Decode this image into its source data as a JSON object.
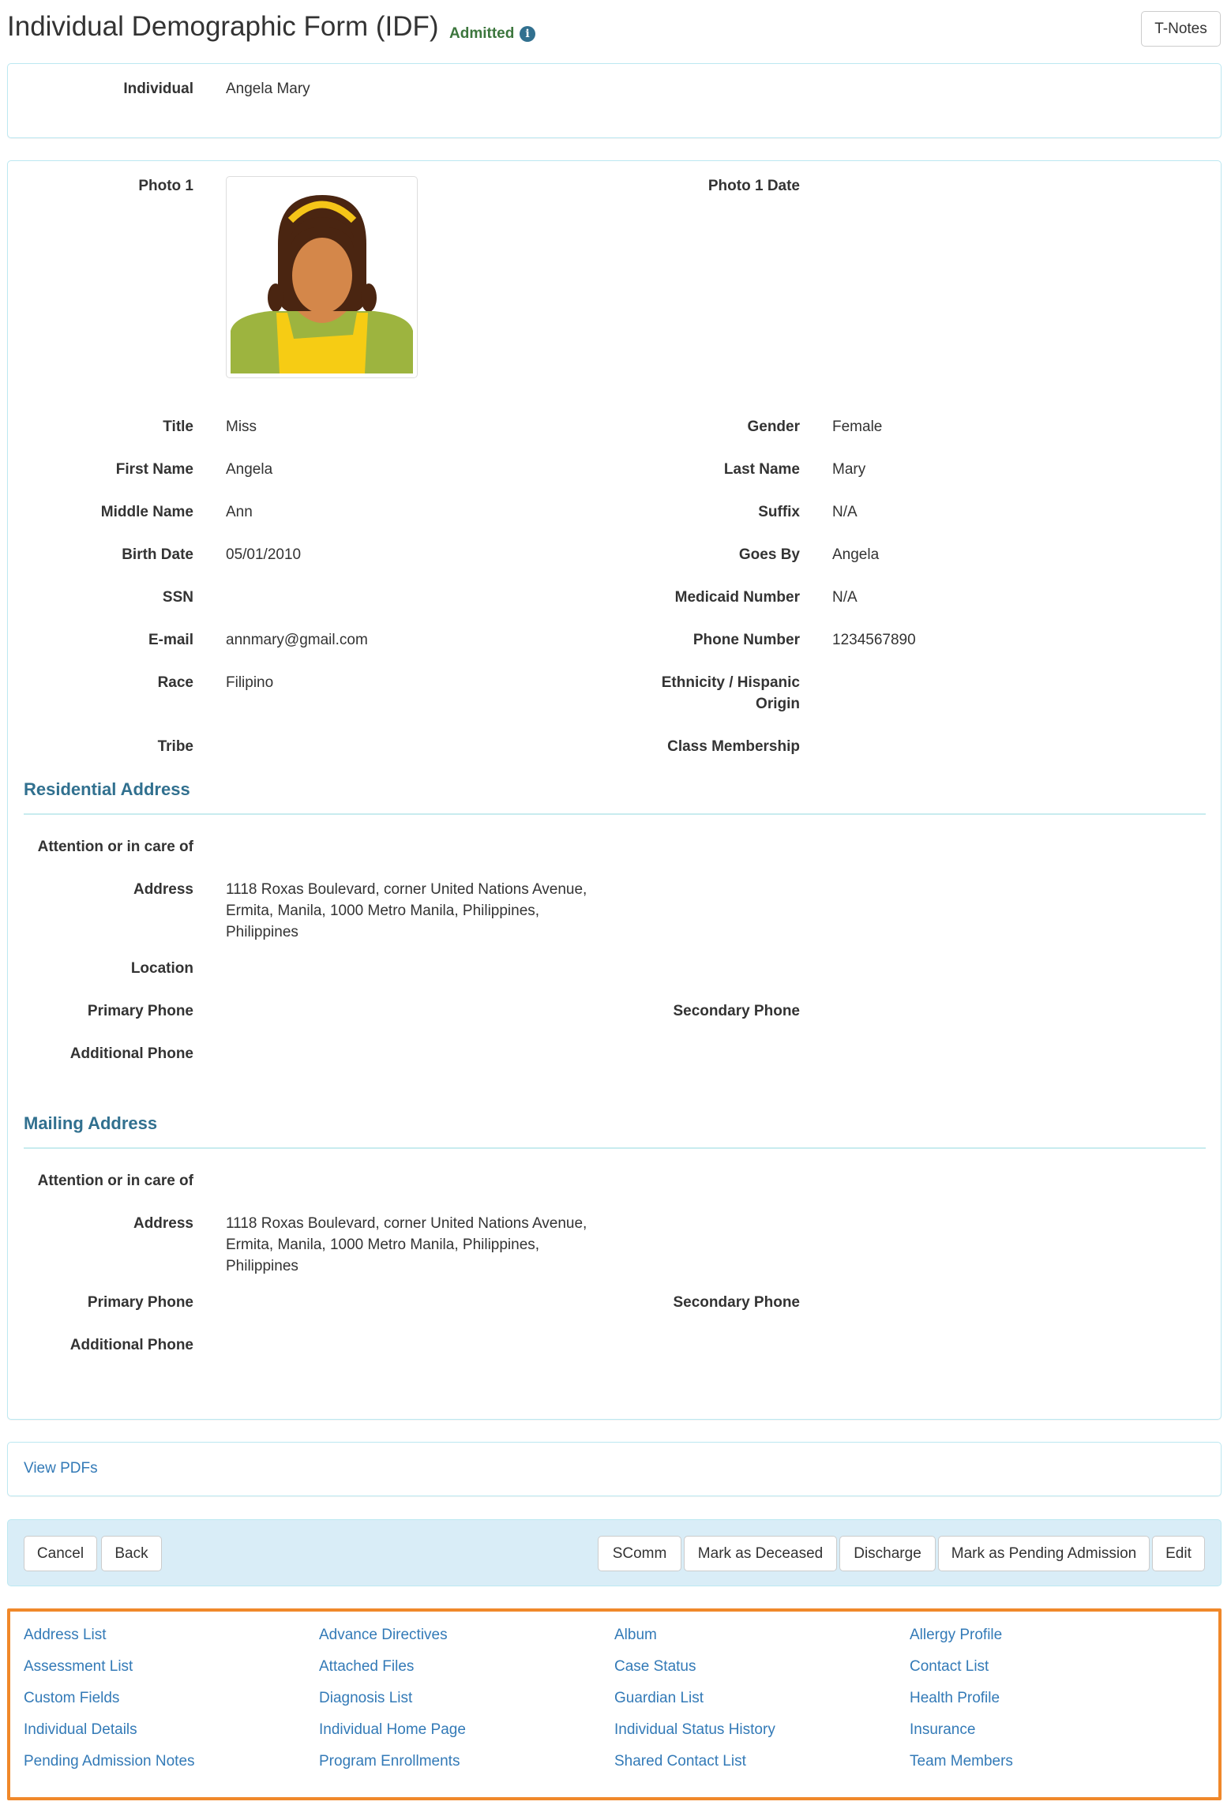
{
  "header": {
    "title": "Individual Demographic Form (IDF)",
    "status": "Admitted",
    "status_color": "#3c763d",
    "info_icon": "info-circle-icon",
    "tnotes_label": "T-Notes"
  },
  "individual": {
    "label": "Individual",
    "value": "Angela Mary"
  },
  "photo": {
    "label": "Photo 1",
    "date_label": "Photo 1 Date",
    "date_value": ""
  },
  "fields": {
    "title": {
      "label": "Title",
      "value": "Miss"
    },
    "gender": {
      "label": "Gender",
      "value": "Female"
    },
    "first_name": {
      "label": "First Name",
      "value": "Angela"
    },
    "last_name": {
      "label": "Last Name",
      "value": "Mary"
    },
    "middle_name": {
      "label": "Middle Name",
      "value": "Ann"
    },
    "suffix": {
      "label": "Suffix",
      "value": "N/A"
    },
    "birth_date": {
      "label": "Birth Date",
      "value": "05/01/2010"
    },
    "goes_by": {
      "label": "Goes By",
      "value": "Angela"
    },
    "ssn": {
      "label": "SSN",
      "value": ""
    },
    "medicaid": {
      "label": "Medicaid Number",
      "value": "N/A"
    },
    "email": {
      "label": "E-mail",
      "value": "annmary@gmail.com"
    },
    "phone": {
      "label": "Phone Number",
      "value": "1234567890"
    },
    "race": {
      "label": "Race",
      "value": "Filipino"
    },
    "ethnicity": {
      "label_line1": "Ethnicity / Hispanic",
      "label_line2": "Origin",
      "value": ""
    },
    "tribe": {
      "label": "Tribe",
      "value": ""
    },
    "class_membership": {
      "label": "Class Membership",
      "value": ""
    }
  },
  "residential": {
    "heading": "Residential Address",
    "attention_label": "Attention or in care of",
    "address_label": "Address",
    "address_lines": [
      "1118 Roxas Boulevard, corner United Nations Avenue,",
      "Ermita, Manila, 1000 Metro Manila, Philippines,",
      "Philippines"
    ],
    "location_label": "Location",
    "primary_phone_label": "Primary Phone",
    "secondary_phone_label": "Secondary Phone",
    "additional_phone_label": "Additional Phone"
  },
  "mailing": {
    "heading": "Mailing Address",
    "attention_label": "Attention or in care of",
    "address_label": "Address",
    "address_lines": [
      "1118 Roxas Boulevard, corner United Nations Avenue,",
      "Ermita, Manila, 1000 Metro Manila, Philippines,",
      "Philippines"
    ],
    "primary_phone_label": "Primary Phone",
    "secondary_phone_label": "Secondary Phone",
    "additional_phone_label": "Additional Phone"
  },
  "view_pdfs": "View PDFs",
  "actions": {
    "left": [
      "Cancel",
      "Back"
    ],
    "right": [
      "SComm",
      "Mark as Deceased",
      "Discharge",
      "Mark as Pending Admission",
      "Edit"
    ]
  },
  "links": [
    [
      "Address List",
      "Assessment List",
      "Custom Fields",
      "Individual Details",
      "Pending Admission Notes"
    ],
    [
      "Advance Directives",
      "Attached Files",
      "Diagnosis List",
      "Individual Home Page",
      "Program Enrollments"
    ],
    [
      "Album",
      "Case Status",
      "Guardian List",
      "Individual Status History",
      "Shared Contact List"
    ],
    [
      "Allergy Profile",
      "Contact List",
      "Health Profile",
      "Insurance",
      "Team Members"
    ]
  ],
  "colors": {
    "link": "#337ab7",
    "section": "#31708f",
    "links_border": "#f0882a",
    "bar_bg": "#d9edf7"
  }
}
